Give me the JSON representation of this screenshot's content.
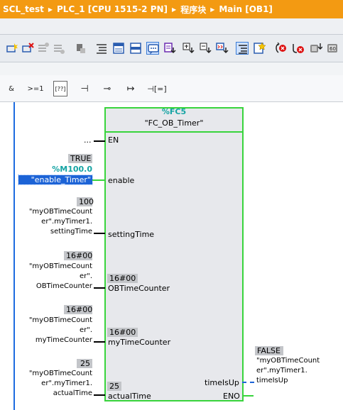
{
  "breadcrumb": {
    "items": [
      "SCL_test",
      "PLC_1 [CPU 1515-2 PN]",
      "程序块",
      "Main [OB1]"
    ]
  },
  "toolbar": {
    "icons": [
      "insert-network-icon",
      "delete-network-icon",
      "insert-row-icon",
      "add-row-icon",
      "reset-start-values-icon",
      "show-abs-operands-icon",
      "show-favorites-icon",
      "show-comments-icon",
      "show-network-comments-icon",
      "show-symbol-info-icon",
      "open-all-networks-icon",
      "close-all-networks-icon",
      "absolute-symbolic-icon",
      "show-overview-icon",
      "favorites-star-icon",
      "go-to-error-prev-icon",
      "go-to-error-next-icon",
      "download-icon",
      "monitor-icon"
    ]
  },
  "lad_toolbar": {
    "items": [
      "&",
      ">=1",
      "[??]",
      "⊣",
      "⊸",
      "↦",
      "⊣[=]"
    ]
  },
  "block": {
    "instance": "%FC5",
    "name": "\"FC_OB_Timer\"",
    "inputs": {
      "en": "EN",
      "enable": "enable",
      "settingTime": "settingTime",
      "obTimeCounter": "OBTimeCounter",
      "myTimeCounter": "myTimeCounter",
      "actualTime": "actualTime"
    },
    "outputs": {
      "timeIsUp": "timeIsUp",
      "eno": "ENO"
    },
    "defaults": {
      "obTimeCounter": "16#00",
      "myTimeCounter": "16#00",
      "actualTime": "25"
    }
  },
  "operands": {
    "en": "...",
    "enable": {
      "value": "TRUE",
      "address": "%M100.0",
      "tag": "\"enable_Timer\""
    },
    "settingTime": {
      "value": "100",
      "lines": [
        "\"myOBTimeCount",
        "er\".myTimer1.",
        "settingTime"
      ]
    },
    "obTimeCounter": {
      "value": "16#00",
      "lines": [
        "\"myOBTimeCount",
        "er\".",
        "OBTimeCounter"
      ]
    },
    "myTimeCounter": {
      "value": "16#00",
      "lines": [
        "\"myOBTimeCount",
        "er\".",
        "myTimeCounter"
      ]
    },
    "actualTime": {
      "value": "25",
      "lines": [
        "\"myOBTimeCount",
        "er\".myTimer1.",
        "actualTime"
      ]
    },
    "timeIsUp": {
      "value": "FALSE",
      "lines": [
        "\"myOBTimeCount",
        "er\".myTimer1.",
        "timeIsUp"
      ]
    }
  }
}
